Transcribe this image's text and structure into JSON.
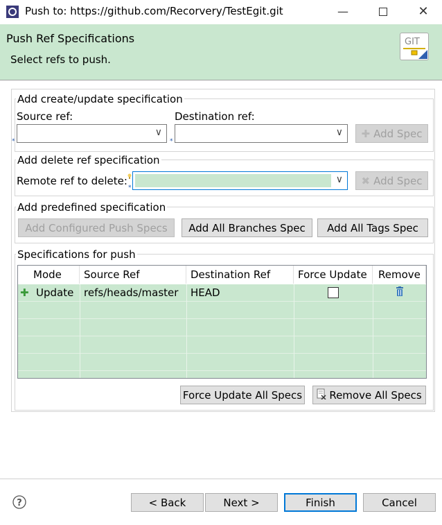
{
  "window": {
    "title": "Push to: https://github.com/Recorvery/TestEgit.git"
  },
  "header": {
    "title": "Push Ref Specifications",
    "subtitle": "Select refs to push.",
    "logo_text": "GIT"
  },
  "create_update": {
    "group_label": "Add create/update specification",
    "source_label": "Source ref:",
    "source_value": "",
    "destination_label": "Destination ref:",
    "destination_value": "",
    "add_spec_label": "Add Spec"
  },
  "delete_ref": {
    "group_label": "Add delete ref specification",
    "remote_label": "Remote ref to delete:",
    "remote_value": "",
    "add_spec_label": "Add Spec"
  },
  "predefined": {
    "group_label": "Add predefined specification",
    "configured_label": "Add Configured Push Specs",
    "branches_label": "Add All Branches Spec",
    "tags_label": "Add All Tags Spec"
  },
  "specs": {
    "group_label": "Specifications for push",
    "columns": [
      "Mode",
      "Source Ref",
      "Destination Ref",
      "Force Update",
      "Remove"
    ],
    "rows": [
      {
        "mode": "Update",
        "source": "refs/heads/master",
        "destination": "HEAD",
        "force": false
      }
    ],
    "force_all_label": "Force Update All Specs",
    "remove_all_label": "Remove All Specs"
  },
  "footer": {
    "back_label": "< Back",
    "next_label": "Next >",
    "finish_label": "Finish",
    "cancel_label": "Cancel"
  },
  "colors": {
    "header_bg": "#c9e7cf",
    "row_bg": "#c9e7cf",
    "accent": "#0078d7"
  }
}
